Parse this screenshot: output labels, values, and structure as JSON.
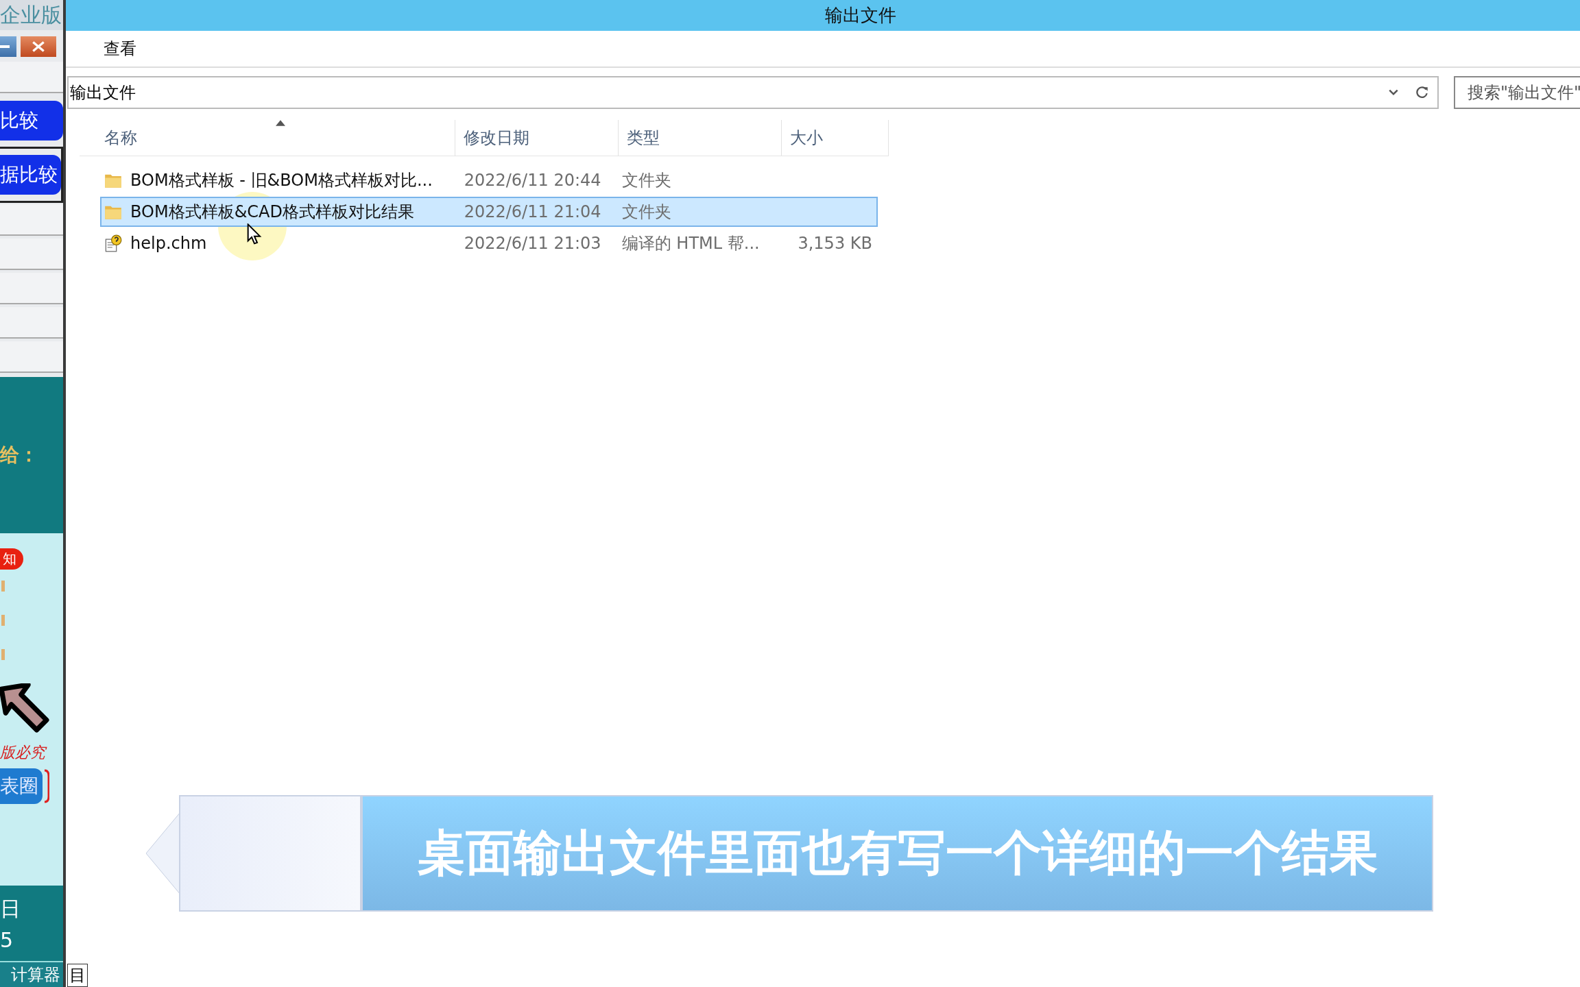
{
  "side_panel": {
    "title": "企业版",
    "compare_buttons": [
      {
        "label": "比较",
        "focused": false
      },
      {
        "label": "据比较",
        "focused": true
      }
    ],
    "notice_label": "给：",
    "badge": "知",
    "copyright": "版必究",
    "pill_button": "表圈",
    "date_fragment": "日",
    "number_fragment": "5",
    "calculator_button": "计算器"
  },
  "window": {
    "title": "输出文件",
    "menu": [
      "查看"
    ],
    "address": "输出文件",
    "search": {
      "placeholder": "搜索\"输出文件\""
    }
  },
  "file_list": {
    "columns": [
      {
        "label": "名称",
        "sorted": true
      },
      {
        "label": "修改日期",
        "sorted": false
      },
      {
        "label": "类型",
        "sorted": false
      },
      {
        "label": "大小",
        "sorted": false
      }
    ],
    "rows": [
      {
        "kind": "folder",
        "name": "BOM格式样板 - 旧&BOM格式样板对比...",
        "modified": "2022/6/11 20:44",
        "type": "文件夹",
        "selected": false
      },
      {
        "kind": "folder",
        "name": "BOM格式样板&CAD格式样板对比结果",
        "modified": "2022/6/11 21:04",
        "type": "文件夹",
        "selected": true
      },
      {
        "kind": "help",
        "name": "help.chm",
        "modified": "2022/6/11 21:03",
        "type": "编译的 HTML 帮...",
        "size": "3,153 KB",
        "selected": false
      }
    ]
  },
  "caption": {
    "text": "桌面输出文件里面也有写一个详细的一个结果"
  },
  "taskbar_fragment": "目"
}
